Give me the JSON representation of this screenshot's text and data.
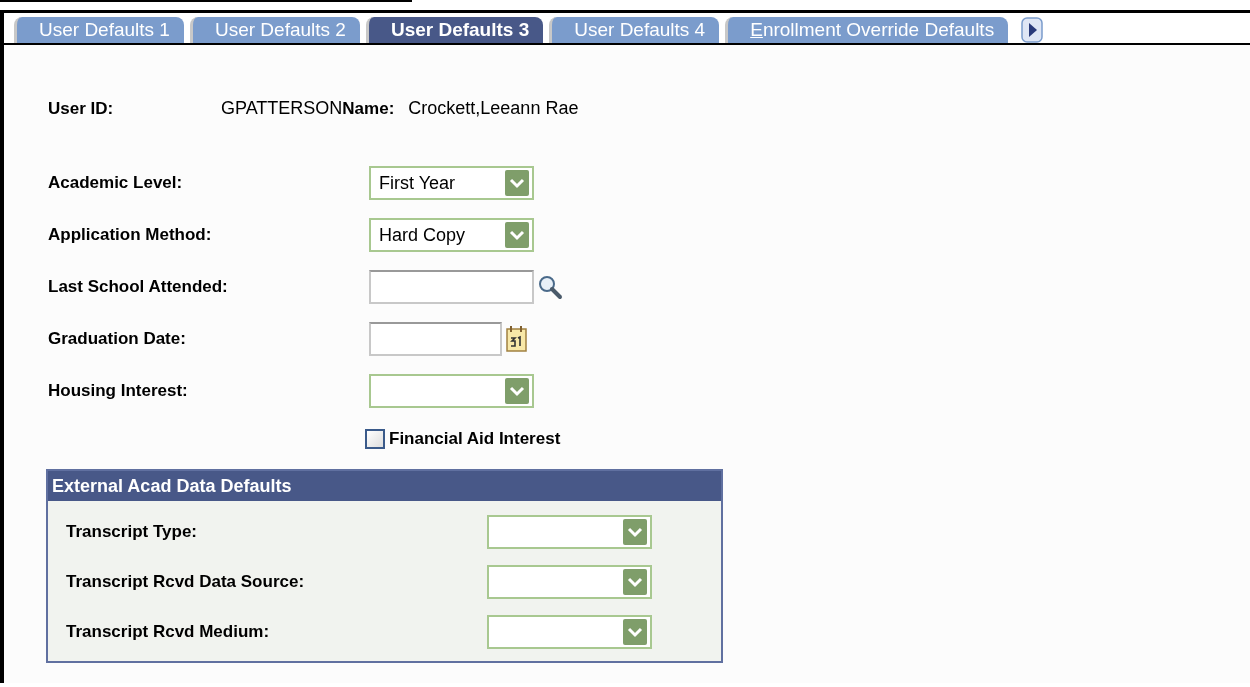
{
  "tabs": [
    {
      "label": "User Defaults 1",
      "selected": false
    },
    {
      "label": "User Defaults 2",
      "selected": false
    },
    {
      "label": "User Defaults 3",
      "selected": true
    },
    {
      "label": "User Defaults 4",
      "selected": false
    },
    {
      "label": "Enrollment Override Defaults",
      "selected": false,
      "first_letter_underlined": true
    }
  ],
  "header": {
    "user_id_label": "User ID:",
    "user_id": "GPATTERSON",
    "name_label": "Name:",
    "name": "Crockett,Leeann Rae"
  },
  "fields": [
    {
      "kind": "dropdown",
      "label": "Academic Level:",
      "value": "First Year"
    },
    {
      "kind": "dropdown",
      "label": "Application Method:",
      "value": "Hard Copy"
    },
    {
      "kind": "lookup",
      "label": "Last School Attended:"
    },
    {
      "kind": "date",
      "label": "Graduation Date:"
    },
    {
      "kind": "dropdown",
      "label": "Housing Interest:"
    }
  ],
  "financial_aid": {
    "label": "Financial Aid Interest",
    "checked": false
  },
  "external_group": {
    "title": "External Acad Data Defaults",
    "fields": [
      {
        "kind": "dropdown",
        "label": "Transcript Type:"
      },
      {
        "kind": "dropdown",
        "label": "Transcript Rcvd Data Source:"
      },
      {
        "kind": "dropdown",
        "label": "Transcript Rcvd Medium:"
      }
    ]
  }
}
